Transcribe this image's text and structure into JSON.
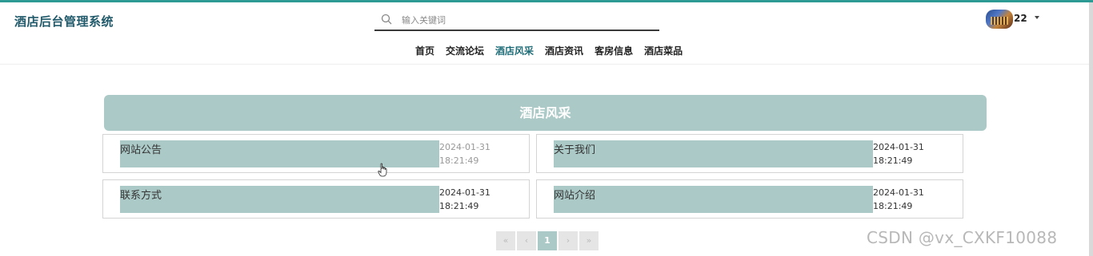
{
  "header": {
    "brand": "酒店后台管理系统",
    "search": {
      "placeholder": "输入关键词",
      "value": ""
    },
    "user": {
      "name": "22"
    }
  },
  "nav": {
    "items": [
      {
        "label": "首页"
      },
      {
        "label": "交流论坛"
      },
      {
        "label": "酒店风采",
        "active": true
      },
      {
        "label": "酒店资讯"
      },
      {
        "label": "客房信息"
      },
      {
        "label": "酒店菜品"
      }
    ]
  },
  "main": {
    "banner": "酒店风采",
    "cards": [
      {
        "title": "网站公告",
        "date": "2024-01-31",
        "time": "18:21:49"
      },
      {
        "title": "关于我们",
        "date": "2024-01-31",
        "time": "18:21:49"
      },
      {
        "title": "联系方式",
        "date": "2024-01-31",
        "time": "18:21:49"
      },
      {
        "title": "网站介绍",
        "date": "2024-01-31",
        "time": "18:21:49"
      }
    ]
  },
  "pagination": {
    "first": "«",
    "prev": "‹",
    "current": "1",
    "next": "›",
    "last": "»"
  },
  "watermark": "CSDN @vx_CXKF10088",
  "colors": {
    "accent": "#abc9c6",
    "brand_text": "#215a6b",
    "active_nav": "#1f6d78",
    "top_line": "#2e9a94"
  }
}
